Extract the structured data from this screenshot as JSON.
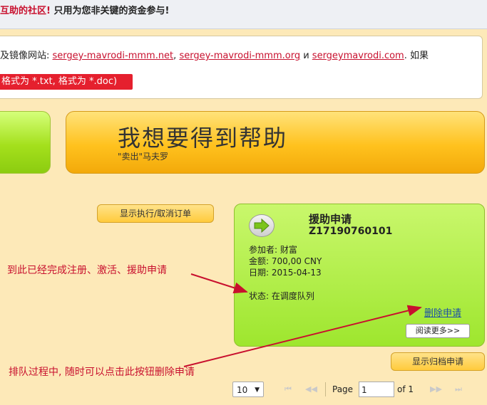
{
  "topbar": {
    "red_text": "互助的社区!",
    "rest_text": " 只用为您非关键的资金参与!"
  },
  "notice": {
    "prefix": "及镜像网站: ",
    "links": [
      "sergey-mavrodi-mmm.net",
      "sergey-mavrodi-mmm.org",
      "sergeymavrodi.com"
    ],
    "sep1": ", ",
    "sep2": " и ",
    "suffix": ". 如果",
    "red_box": "格式为 *.txt, 格式为 *.doc)"
  },
  "help_button": {
    "title": "我想要得到帮助",
    "subtitle": "\"卖出\"马夫罗"
  },
  "show_orders_button": "显示执行/取消订单",
  "card": {
    "icon": "arrow-right-icon",
    "title": "援助申请",
    "number": "Z17190760101",
    "participant": "参加者: 财富",
    "amount": "金额: 700,00 CNY",
    "date": "日期: 2015-04-13",
    "status": "状态: 在调度队列",
    "delete_link": "删除申请",
    "read_more": "阅读更多>>"
  },
  "archive_button": "显示归档申请",
  "annotations": {
    "note1": "到此已经完成注册、激活、援助申请",
    "note2": "排队过程中, 随时可以点击此按钮删除申请"
  },
  "pager": {
    "page_size": "10",
    "page_label": "Page",
    "page_value": "1",
    "of_label": "of 1"
  },
  "colors": {
    "annotation": "#c8102e",
    "card_green": "#9ee62e",
    "help_orange": "#ffc21e"
  }
}
